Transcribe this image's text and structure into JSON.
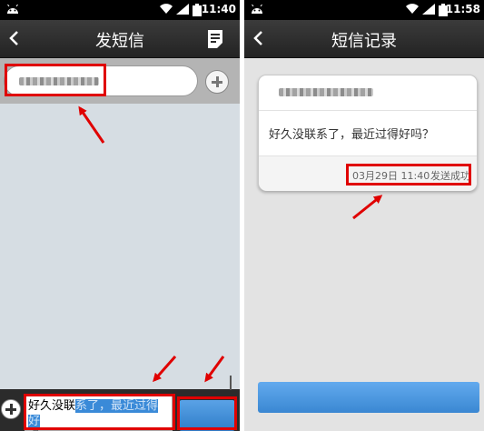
{
  "left_screen": {
    "status_time": "11:40",
    "title": "发短信",
    "compose_text_plain": "好久没联",
    "compose_text_selected": "系了，最近过得好",
    "compose_text_line2": "吗？"
  },
  "right_screen": {
    "status_time": "11:58",
    "title": "短信记录",
    "message_text": "好久没联系了，最近过得好吗？",
    "message_datetime": "03月29日 11:40",
    "message_status": "发送成功"
  },
  "colors": {
    "highlight": "#e00000",
    "send_button": "#3a87d2",
    "titlebar": "#2b2b2b"
  }
}
